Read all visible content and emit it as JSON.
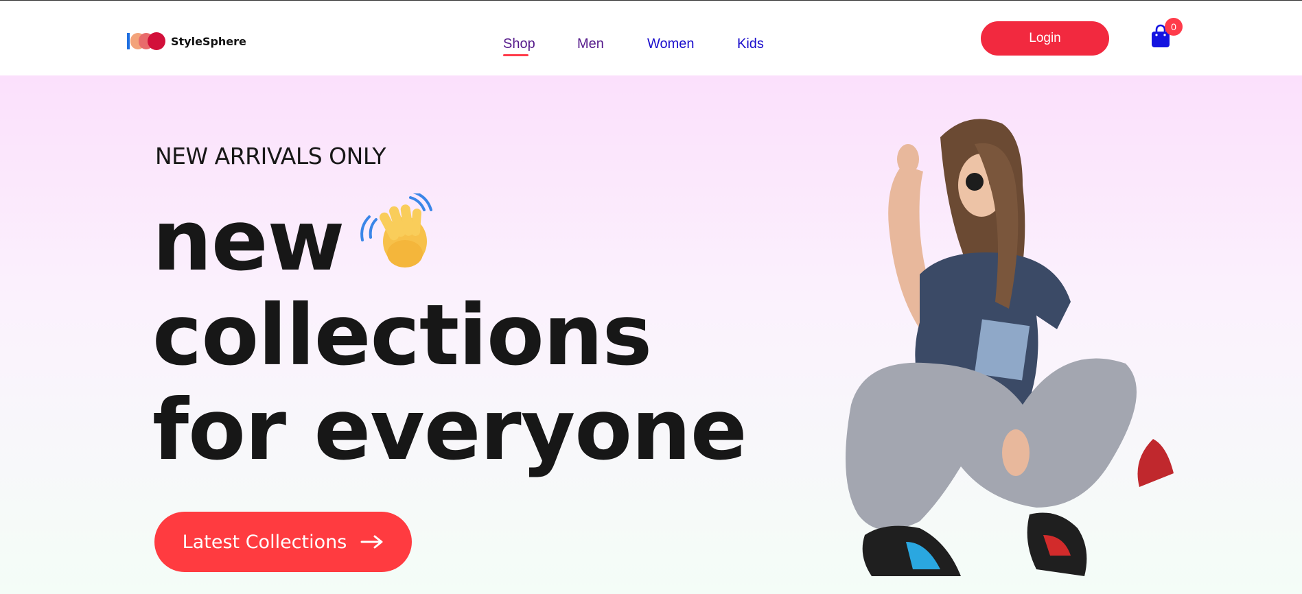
{
  "brand": {
    "name": "StyleSphere"
  },
  "nav": {
    "items": [
      {
        "label": "Shop",
        "active": true
      },
      {
        "label": "Men"
      },
      {
        "label": "Women"
      },
      {
        "label": "Kids"
      }
    ]
  },
  "header": {
    "login_label": "Login",
    "cart_count": "0",
    "cart_icon": "shopping-bag-icon"
  },
  "hero": {
    "eyebrow": "NEW ARRIVALS ONLY",
    "headline_line1": "new",
    "headline_line2": "collections",
    "headline_line3": "for everyone",
    "wave_icon": "waving-hand-icon",
    "cta_label": "Latest Collections",
    "cta_icon": "arrow-right-icon"
  },
  "colors": {
    "accent": "#f2293f",
    "cta": "#ff3b40",
    "hero_top": "#fbe0fc",
    "hero_bottom": "#f4fdf7",
    "text": "#171717"
  }
}
